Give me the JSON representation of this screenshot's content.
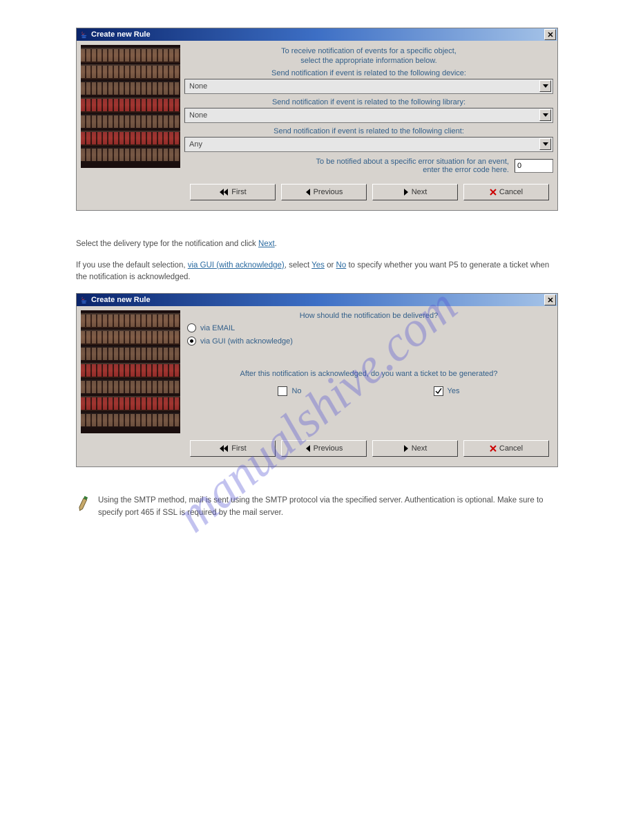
{
  "watermark": "manualshive.com",
  "dialog1": {
    "title": "Create new Rule",
    "intro_line1": "To receive notification of events for a specific object,",
    "intro_line2": "select the appropriate information below.",
    "device_label": "Send notification if event is related to the following device:",
    "device_value": "None",
    "library_label": "Send notification if event is related to the following library:",
    "library_value": "None",
    "client_label": "Send notification if event is related to the following client:",
    "client_value": "Any",
    "errorcode_label_line1": "To be notified about a specific error situation for an event,",
    "errorcode_label_line2": "enter the error code here.",
    "errorcode_value": "0"
  },
  "prose": {
    "line1_pre": "Select the delivery type for the notification and click ",
    "link_next": "Next",
    "line1_post": ".",
    "para2_a": "If you use the default selection, ",
    "para2_b": "via GUI (with acknowledge)",
    "para2_c": ", select ",
    "para2_d": "Yes",
    "para2_e": " or ",
    "para2_f": "No",
    "para2_g": " to specify whether you want P5 to generate a ticket when the notification is acknowledged."
  },
  "dialog2": {
    "title": "Create new Rule",
    "question": "How should the notification be delivered?",
    "radio_email": "via EMAIL",
    "radio_gui": "via GUI (with acknowledge)",
    "ack_question": "After this notification is acknowledged, do you want a ticket to be generated?",
    "no_label": "No",
    "yes_label": "Yes"
  },
  "buttons": {
    "first": "First",
    "previous": "Previous",
    "next": "Next",
    "cancel": "Cancel"
  },
  "note": {
    "text": "Using the SMTP method, mail is sent using the SMTP protocol via the specified server. Authentication is optional. Make sure to specify port 465 if SSL is required by the mail server."
  }
}
